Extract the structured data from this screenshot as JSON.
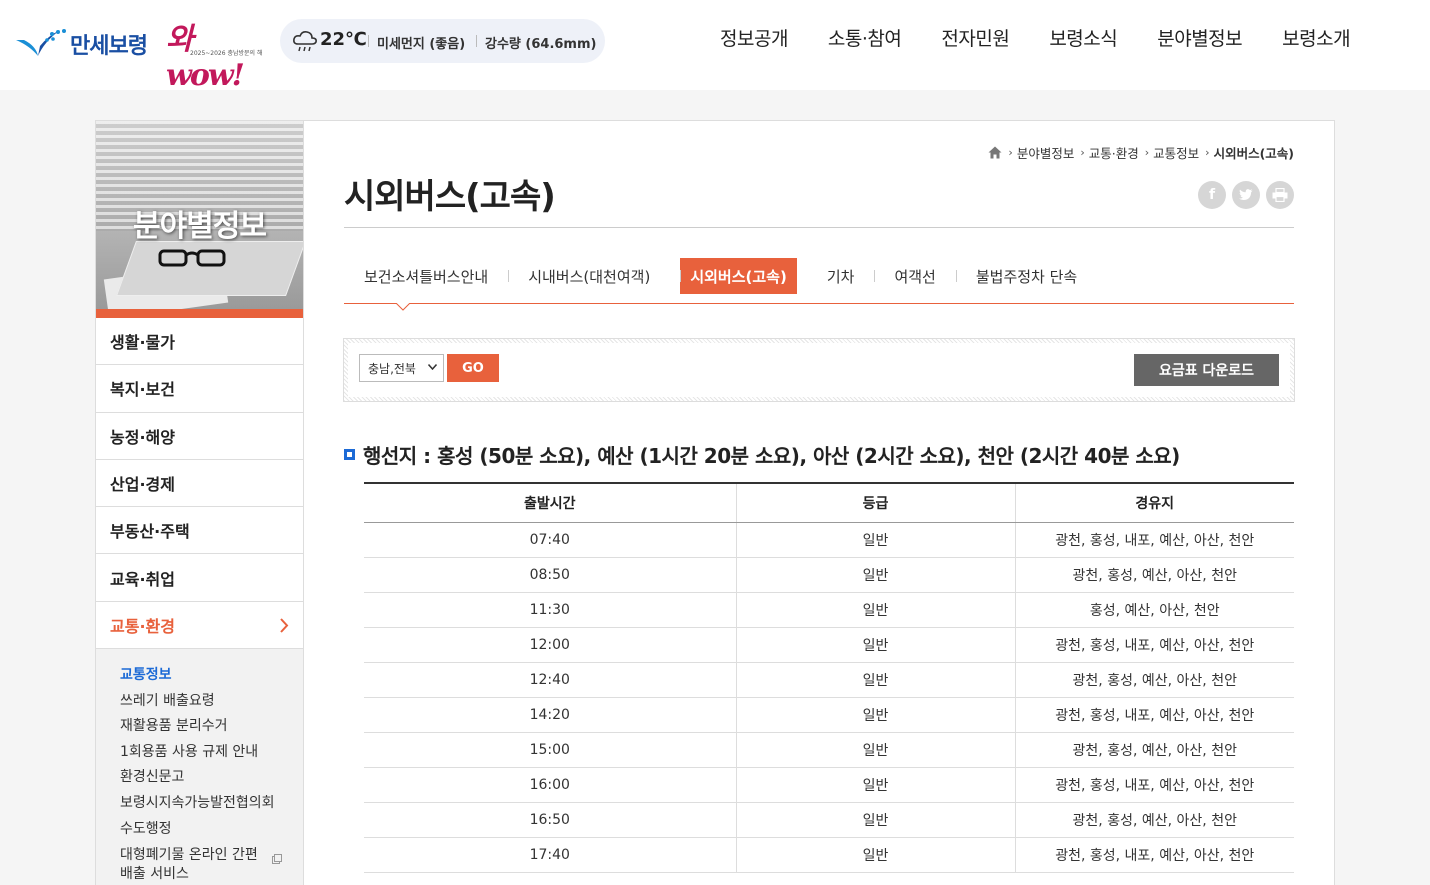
{
  "header": {
    "logo_text": "만세보령",
    "logo_slogan": "와wow!",
    "logo_sub": "2025~2026 충남방문의 해",
    "weather": {
      "temperature": "22℃",
      "fine_dust": "미세먼지 (좋음)",
      "rainfall": "강수량 (64.6mm)"
    },
    "gnb": [
      "정보공개",
      "소통·참여",
      "전자민원",
      "보령소식",
      "분야별정보",
      "보령소개"
    ]
  },
  "lnb": {
    "title": "분야별정보",
    "menu": [
      {
        "label": "생활·물가",
        "active": false
      },
      {
        "label": "복지·보건",
        "active": false
      },
      {
        "label": "농정·해양",
        "active": false
      },
      {
        "label": "산업·경제",
        "active": false
      },
      {
        "label": "부동산·주택",
        "active": false
      },
      {
        "label": "교육·취업",
        "active": false
      },
      {
        "label": "교통·환경",
        "active": true
      }
    ],
    "submenu": [
      {
        "label": "교통정보",
        "active": true
      },
      {
        "label": "쓰레기 배출요령",
        "active": false
      },
      {
        "label": "재활용품 분리수거",
        "active": false
      },
      {
        "label": "1회용품 사용 규제 안내",
        "active": false
      },
      {
        "label": "환경신문고",
        "active": false
      },
      {
        "label": "보령시지속가능발전협의회",
        "active": false
      },
      {
        "label": "수도행정",
        "active": false
      },
      {
        "label": "대형폐기물 온라인 간편배출 서비스",
        "active": false,
        "external": true
      }
    ]
  },
  "breadcrumb": [
    "분야별정보",
    "교통·환경",
    "교통정보",
    "시외버스(고속)"
  ],
  "page_title": "시외버스(고속)",
  "sns": {
    "facebook": "f",
    "twitter": "t",
    "print": "print"
  },
  "tabs": [
    {
      "label": "보건소셔틀버스안내",
      "active": false
    },
    {
      "label": "시내버스(대천여객)",
      "active": false
    },
    {
      "label": "시외버스(고속)",
      "active": true
    },
    {
      "label": "기차",
      "active": false
    },
    {
      "label": "여객선",
      "active": false
    },
    {
      "label": "불법주정차 단속",
      "active": false
    }
  ],
  "search": {
    "selected_region": "충남,전북",
    "go_label": "GO",
    "download_label": "요금표 다운로드"
  },
  "route_title": "행선지 : 홍성 (50분 소요), 예산 (1시간 20분 소요), 아산 (2시간 소요), 천안 (2시간 40분 소요)",
  "table": {
    "headers": [
      "출발시간",
      "등급",
      "경유지"
    ],
    "rows": [
      [
        "07:40",
        "일반",
        "광천, 홍성, 내포, 예산, 아산, 천안"
      ],
      [
        "08:50",
        "일반",
        "광천, 홍성, 예산, 아산, 천안"
      ],
      [
        "11:30",
        "일반",
        "홍성, 예산, 아산, 천안"
      ],
      [
        "12:00",
        "일반",
        "광천, 홍성, 내포, 예산, 아산, 천안"
      ],
      [
        "12:40",
        "일반",
        "광천, 홍성, 예산, 아산, 천안"
      ],
      [
        "14:20",
        "일반",
        "광천, 홍성, 내포, 예산, 아산, 천안"
      ],
      [
        "15:00",
        "일반",
        "광천, 홍성, 예산, 아산, 천안"
      ],
      [
        "16:00",
        "일반",
        "광천, 홍성, 내포, 예산, 아산, 천안"
      ],
      [
        "16:50",
        "일반",
        "광천, 홍성, 예산, 아산, 천안"
      ],
      [
        "17:40",
        "일반",
        "광천, 홍성, 내포, 예산, 아산, 천안"
      ]
    ]
  },
  "colors": {
    "accent": "#e8613c",
    "link_blue": "#1c6ad6",
    "logo_blue": "#1a4fa3",
    "download_gray": "#666666"
  }
}
